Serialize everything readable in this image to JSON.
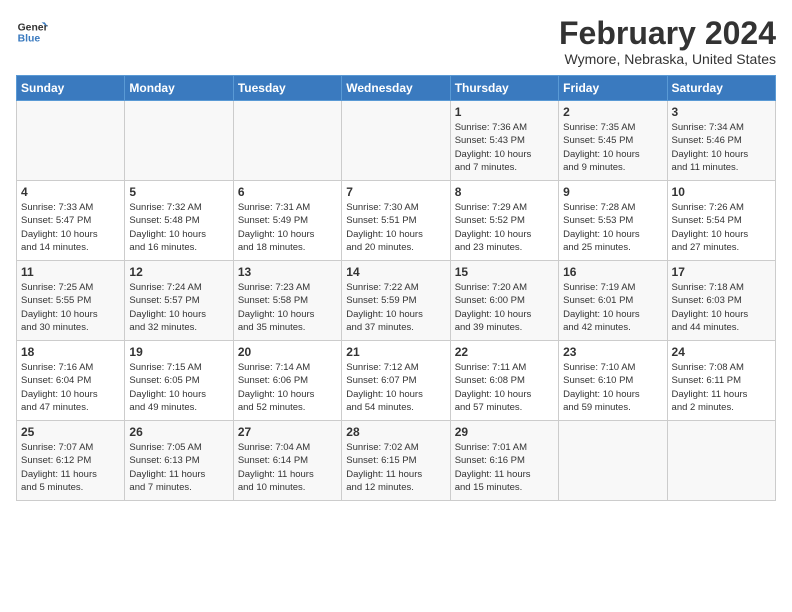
{
  "header": {
    "logo_line1": "General",
    "logo_line2": "Blue",
    "title": "February 2024",
    "subtitle": "Wymore, Nebraska, United States"
  },
  "weekdays": [
    "Sunday",
    "Monday",
    "Tuesday",
    "Wednesday",
    "Thursday",
    "Friday",
    "Saturday"
  ],
  "weeks": [
    [
      {
        "day": "",
        "info": ""
      },
      {
        "day": "",
        "info": ""
      },
      {
        "day": "",
        "info": ""
      },
      {
        "day": "",
        "info": ""
      },
      {
        "day": "1",
        "info": "Sunrise: 7:36 AM\nSunset: 5:43 PM\nDaylight: 10 hours\nand 7 minutes."
      },
      {
        "day": "2",
        "info": "Sunrise: 7:35 AM\nSunset: 5:45 PM\nDaylight: 10 hours\nand 9 minutes."
      },
      {
        "day": "3",
        "info": "Sunrise: 7:34 AM\nSunset: 5:46 PM\nDaylight: 10 hours\nand 11 minutes."
      }
    ],
    [
      {
        "day": "4",
        "info": "Sunrise: 7:33 AM\nSunset: 5:47 PM\nDaylight: 10 hours\nand 14 minutes."
      },
      {
        "day": "5",
        "info": "Sunrise: 7:32 AM\nSunset: 5:48 PM\nDaylight: 10 hours\nand 16 minutes."
      },
      {
        "day": "6",
        "info": "Sunrise: 7:31 AM\nSunset: 5:49 PM\nDaylight: 10 hours\nand 18 minutes."
      },
      {
        "day": "7",
        "info": "Sunrise: 7:30 AM\nSunset: 5:51 PM\nDaylight: 10 hours\nand 20 minutes."
      },
      {
        "day": "8",
        "info": "Sunrise: 7:29 AM\nSunset: 5:52 PM\nDaylight: 10 hours\nand 23 minutes."
      },
      {
        "day": "9",
        "info": "Sunrise: 7:28 AM\nSunset: 5:53 PM\nDaylight: 10 hours\nand 25 minutes."
      },
      {
        "day": "10",
        "info": "Sunrise: 7:26 AM\nSunset: 5:54 PM\nDaylight: 10 hours\nand 27 minutes."
      }
    ],
    [
      {
        "day": "11",
        "info": "Sunrise: 7:25 AM\nSunset: 5:55 PM\nDaylight: 10 hours\nand 30 minutes."
      },
      {
        "day": "12",
        "info": "Sunrise: 7:24 AM\nSunset: 5:57 PM\nDaylight: 10 hours\nand 32 minutes."
      },
      {
        "day": "13",
        "info": "Sunrise: 7:23 AM\nSunset: 5:58 PM\nDaylight: 10 hours\nand 35 minutes."
      },
      {
        "day": "14",
        "info": "Sunrise: 7:22 AM\nSunset: 5:59 PM\nDaylight: 10 hours\nand 37 minutes."
      },
      {
        "day": "15",
        "info": "Sunrise: 7:20 AM\nSunset: 6:00 PM\nDaylight: 10 hours\nand 39 minutes."
      },
      {
        "day": "16",
        "info": "Sunrise: 7:19 AM\nSunset: 6:01 PM\nDaylight: 10 hours\nand 42 minutes."
      },
      {
        "day": "17",
        "info": "Sunrise: 7:18 AM\nSunset: 6:03 PM\nDaylight: 10 hours\nand 44 minutes."
      }
    ],
    [
      {
        "day": "18",
        "info": "Sunrise: 7:16 AM\nSunset: 6:04 PM\nDaylight: 10 hours\nand 47 minutes."
      },
      {
        "day": "19",
        "info": "Sunrise: 7:15 AM\nSunset: 6:05 PM\nDaylight: 10 hours\nand 49 minutes."
      },
      {
        "day": "20",
        "info": "Sunrise: 7:14 AM\nSunset: 6:06 PM\nDaylight: 10 hours\nand 52 minutes."
      },
      {
        "day": "21",
        "info": "Sunrise: 7:12 AM\nSunset: 6:07 PM\nDaylight: 10 hours\nand 54 minutes."
      },
      {
        "day": "22",
        "info": "Sunrise: 7:11 AM\nSunset: 6:08 PM\nDaylight: 10 hours\nand 57 minutes."
      },
      {
        "day": "23",
        "info": "Sunrise: 7:10 AM\nSunset: 6:10 PM\nDaylight: 10 hours\nand 59 minutes."
      },
      {
        "day": "24",
        "info": "Sunrise: 7:08 AM\nSunset: 6:11 PM\nDaylight: 11 hours\nand 2 minutes."
      }
    ],
    [
      {
        "day": "25",
        "info": "Sunrise: 7:07 AM\nSunset: 6:12 PM\nDaylight: 11 hours\nand 5 minutes."
      },
      {
        "day": "26",
        "info": "Sunrise: 7:05 AM\nSunset: 6:13 PM\nDaylight: 11 hours\nand 7 minutes."
      },
      {
        "day": "27",
        "info": "Sunrise: 7:04 AM\nSunset: 6:14 PM\nDaylight: 11 hours\nand 10 minutes."
      },
      {
        "day": "28",
        "info": "Sunrise: 7:02 AM\nSunset: 6:15 PM\nDaylight: 11 hours\nand 12 minutes."
      },
      {
        "day": "29",
        "info": "Sunrise: 7:01 AM\nSunset: 6:16 PM\nDaylight: 11 hours\nand 15 minutes."
      },
      {
        "day": "",
        "info": ""
      },
      {
        "day": "",
        "info": ""
      }
    ]
  ]
}
